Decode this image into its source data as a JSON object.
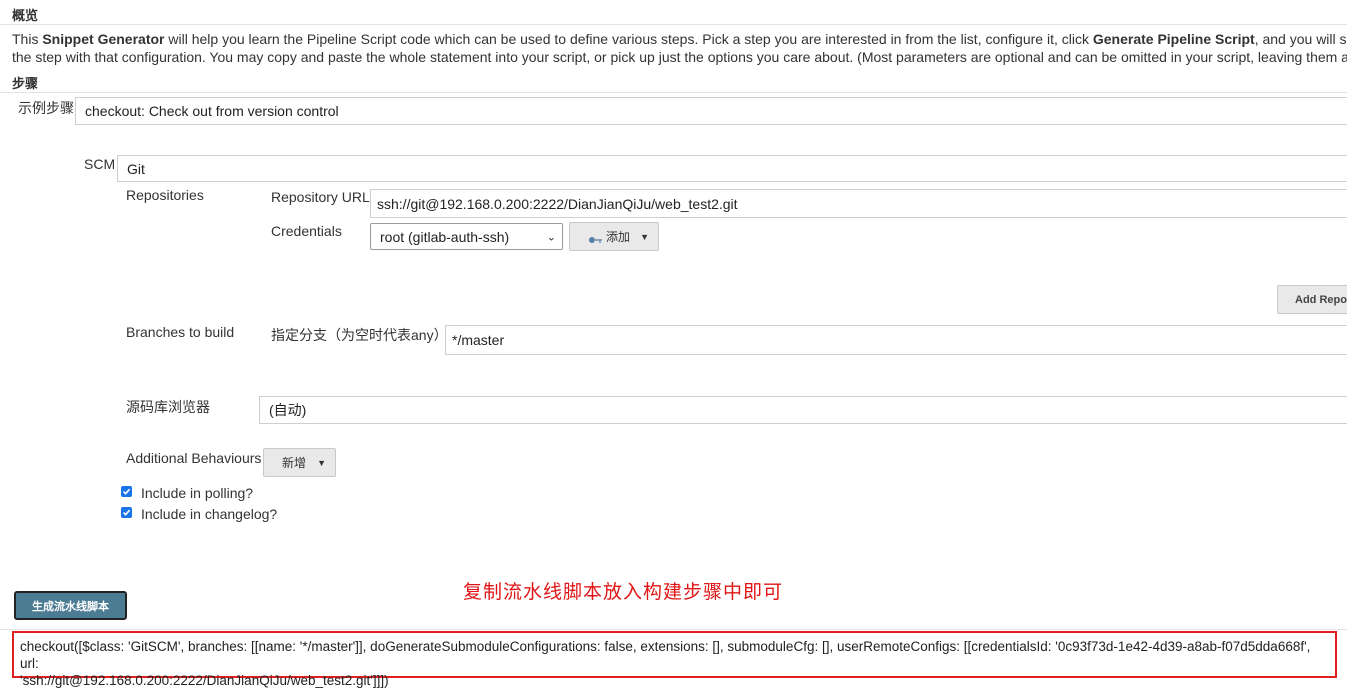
{
  "overview": {
    "title": "概览",
    "desc_part1": "This ",
    "desc_bold1": "Snippet Generator",
    "desc_part2": " will help you learn the Pipeline Script code which can be used to define various steps. Pick a step you are interested in from the list, configure it, click ",
    "desc_bold2": "Generate Pipeline Script",
    "desc_part3": ", and you will see a Pip",
    "desc_line2": "the step with that configuration. You may copy and paste the whole statement into your script, or pick up just the options you care about. (Most parameters are optional and can be omitted in your script, leaving them at defaul"
  },
  "steps": {
    "title": "步骤",
    "sample_step_label": "示例步骤",
    "sample_step_value": "checkout: Check out from version control"
  },
  "scm": {
    "label": "SCM",
    "value": "Git",
    "repositories_label": "Repositories",
    "repo_url_label": "Repository URL",
    "repo_url_value": "ssh://git@192.168.0.200:2222/DianJianQiJu/web_test2.git",
    "credentials_label": "Credentials",
    "credentials_value": "root (gitlab-auth-ssh)",
    "add_button_label": "添加",
    "add_repo_button_label": "Add Repo",
    "branches_label": "Branches to build",
    "branch_specifier_label": "指定分支（为空时代表any）",
    "branch_value": "*/master",
    "browser_label": "源码库浏览器",
    "browser_value": "(自动)",
    "behaviours_label": "Additional Behaviours",
    "behaviours_button_label": "新增",
    "polling_label": "Include in polling?",
    "polling_checked": true,
    "changelog_label": "Include in changelog?",
    "changelog_checked": true
  },
  "generate_button_label": "生成流水线脚本",
  "annotation_text": "复制流水线脚本放入构建步骤中即可",
  "result_line1": "checkout([$class: 'GitSCM', branches: [[name: '*/master']], doGenerateSubmoduleConfigurations: false, extensions: [], submoduleCfg: [], userRemoteConfigs: [[credentialsId: '0c93f73d-1e42-4d39-a8ab-f07d5dda668f', url:",
  "result_line2": "'ssh://git@192.168.0.200:2222/DianJianQiJu/web_test2.git']]])",
  "colors": {
    "generate_button_bg": "#4c7b94",
    "annotation_red": "#e01616",
    "result_border": "#e02020",
    "checkbox_blue": "#1a73e8"
  }
}
